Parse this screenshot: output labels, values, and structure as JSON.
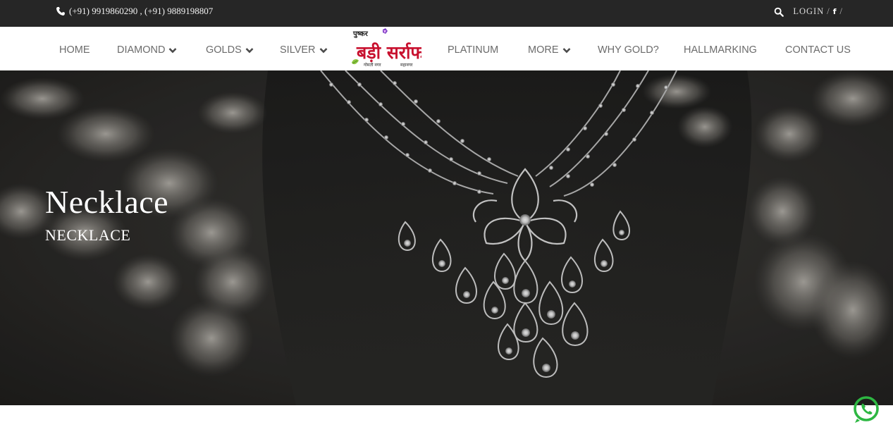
{
  "topbar": {
    "phone": "(+91) 9919860290 , (+91) 9889198807",
    "login_label": "LOGIN",
    "separator": "/",
    "facebook_glyph": "f",
    "icons": {
      "phone": "phone-icon",
      "search": "search-icon",
      "facebook": "facebook-icon"
    }
  },
  "nav": {
    "items": [
      {
        "label": "HOME",
        "dropdown": false
      },
      {
        "label": "DIAMOND",
        "dropdown": true
      },
      {
        "label": "GOLDS",
        "dropdown": true
      },
      {
        "label": "SILVER",
        "dropdown": true
      },
      {
        "label": "PLATINUM",
        "dropdown": false
      },
      {
        "label": "MORE",
        "dropdown": true
      },
      {
        "label": "WHY GOLD?",
        "dropdown": false
      },
      {
        "label": "HALLMARKING",
        "dropdown": false
      },
      {
        "label": "CONTACT US",
        "dropdown": false
      }
    ],
    "logo": {
      "line1": "पुष्कर",
      "main": "बड़ी सर्राफ",
      "footer_left": "गोमती नगर",
      "footer_right": "महानगर"
    }
  },
  "hero": {
    "title": "Necklace",
    "subtitle": "NECKLACE"
  },
  "colors": {
    "topbar_bg": "#262626",
    "nav_text": "#6b6b6b",
    "logo_red": "#c8102e",
    "whatsapp_green": "#2db742"
  }
}
